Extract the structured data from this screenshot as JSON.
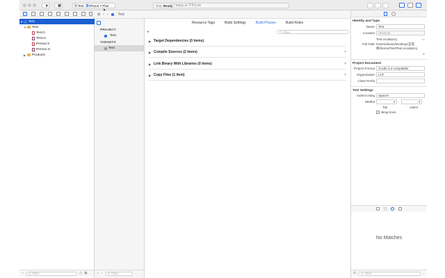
{
  "toolbar": {
    "scheme_target": "Test",
    "scheme_device": "iPhone 7 Plus",
    "status_project": "Test:",
    "status_state": "Ready",
    "status_time": "| Today at 下午2:29"
  },
  "navigator": {
    "items": [
      {
        "label": "Test",
        "kind": "project",
        "indent": 0,
        "selected": true,
        "expanded": true
      },
      {
        "label": "Test",
        "kind": "folder",
        "indent": 1,
        "selected": false,
        "expanded": true
      },
      {
        "label": "Test.h",
        "kind": "header",
        "indent": 2,
        "selected": false
      },
      {
        "label": "Test.m",
        "kind": "source",
        "indent": 2,
        "selected": false
      },
      {
        "label": "Person.h",
        "kind": "header",
        "indent": 2,
        "selected": false
      },
      {
        "label": "Person.m",
        "kind": "source",
        "indent": 2,
        "selected": false
      },
      {
        "label": "Products",
        "kind": "folder",
        "indent": 1,
        "selected": false,
        "expanded": false
      }
    ],
    "filter_placeholder": "Filter"
  },
  "jumpbar": {
    "file": "Test"
  },
  "sidebar": {
    "project_heading": "PROJECT",
    "project_item": "Test",
    "targets_heading": "TARGETS",
    "target_item": "Test",
    "filter_placeholder": "Filter"
  },
  "tabs": [
    "Resource Tags",
    "Build Settings",
    "Build Phases",
    "Build Rules"
  ],
  "active_tab": "Build Phases",
  "phases": {
    "filter_placeholder": "Filter",
    "add_label": "+",
    "items": [
      {
        "label": "Target Dependencies (0 items)",
        "removable": false
      },
      {
        "label": "Compile Sources (2 items)",
        "removable": true
      },
      {
        "label": "Link Binary With Libraries (0 items)",
        "removable": true
      },
      {
        "label": "Copy Files (1 item)",
        "removable": true
      }
    ]
  },
  "inspector": {
    "identity_title": "Identity and Type",
    "name_label": "Name",
    "name_value": "Test",
    "location_label": "Location",
    "location_value": "Absolute",
    "file_name": "Test.xcodeproj",
    "full_path_label": "Full Path",
    "full_path_value": "/Users/dewei/Desktop/正常库/Demo/Test/Test.xcodeproj",
    "project_doc_title": "Project Document",
    "format_label": "Project Format",
    "format_value": "Xcode 3.2-compatible",
    "org_label": "Organization",
    "org_value": "LCF",
    "prefix_label": "Class Prefix",
    "prefix_value": "",
    "text_settings_title": "Text Settings",
    "indent_label": "Indent Using",
    "indent_value": "Spaces",
    "widths_label": "Widths",
    "tab_width": "4",
    "indent_width": "4",
    "tab_caption": "Tab",
    "indent_caption": "Indent",
    "wrap_label": "Wrap lines",
    "no_matches": "No Matches",
    "filter_placeholder": "Filter"
  },
  "colors": {
    "accent": "#2d6fe4",
    "selection": "#1b5fd1",
    "folder": "#e9b64c"
  }
}
